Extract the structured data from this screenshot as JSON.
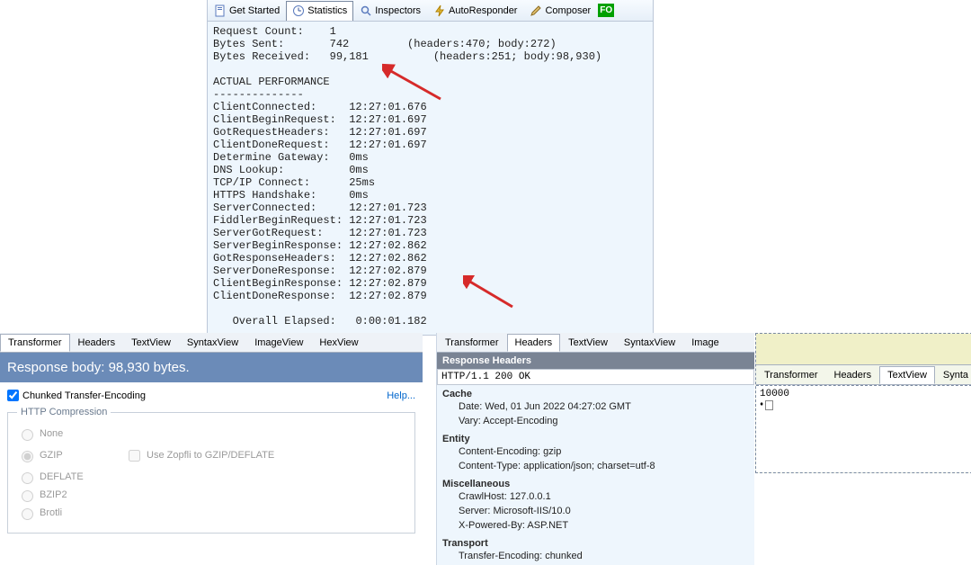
{
  "top": {
    "tabs": {
      "get_started": "Get Started",
      "statistics": "Statistics",
      "inspectors": "Inspectors",
      "autoresponder": "AutoResponder",
      "composer": "Composer",
      "fo": "FO"
    },
    "stats": {
      "request_count_label": "Request Count:    ",
      "request_count_value": "1",
      "bytes_sent_label": "Bytes Sent:       ",
      "bytes_sent_value": "742",
      "bytes_sent_detail": "(headers:470; body:272)",
      "bytes_received_label": "Bytes Received:   ",
      "bytes_received_value": "99,181",
      "bytes_received_detail": "(headers:251; body:98,930)",
      "actual_perf": "ACTUAL PERFORMANCE",
      "rule": "--------------",
      "rows": [
        [
          "ClientConnected:     ",
          "12:27:01.676"
        ],
        [
          "ClientBeginRequest:  ",
          "12:27:01.697"
        ],
        [
          "GotRequestHeaders:   ",
          "12:27:01.697"
        ],
        [
          "ClientDoneRequest:   ",
          "12:27:01.697"
        ],
        [
          "Determine Gateway:   ",
          "0ms"
        ],
        [
          "DNS Lookup:          ",
          "0ms"
        ],
        [
          "TCP/IP Connect:      ",
          "25ms"
        ],
        [
          "HTTPS Handshake:     ",
          "0ms"
        ],
        [
          "ServerConnected:     ",
          "12:27:01.723"
        ],
        [
          "FiddlerBeginRequest: ",
          "12:27:01.723"
        ],
        [
          "ServerGotRequest:    ",
          "12:27:01.723"
        ],
        [
          "ServerBeginResponse: ",
          "12:27:02.862"
        ],
        [
          "GotResponseHeaders:  ",
          "12:27:02.862"
        ],
        [
          "ServerDoneResponse:  ",
          "12:27:02.879"
        ],
        [
          "ClientBeginResponse: ",
          "12:27:02.879"
        ],
        [
          "ClientDoneResponse:  ",
          "12:27:02.879"
        ]
      ],
      "overall_label": "   Overall Elapsed:   ",
      "overall_value": "0:00:01.182"
    }
  },
  "bl": {
    "tabs": [
      "Transformer",
      "Headers",
      "TextView",
      "SyntaxView",
      "ImageView",
      "HexView"
    ],
    "response_body": "Response body: 98,930 bytes.",
    "chunked": "Chunked Transfer-Encoding",
    "help": "Help...",
    "compress_legend": "HTTP Compression",
    "radios": [
      "None",
      "GZIP",
      "DEFLATE",
      "BZIP2",
      "Brotli"
    ],
    "zopfli": "Use Zopfli to GZIP/DEFLATE"
  },
  "bm": {
    "tabs": [
      "Transformer",
      "Headers",
      "TextView",
      "SyntaxView",
      "Image"
    ],
    "bar": "Response Headers",
    "status": "HTTP/1.1 200 OK",
    "groups": [
      {
        "title": "Cache",
        "items": [
          "Date: Wed, 01 Jun 2022 04:27:02 GMT",
          "Vary: Accept-Encoding"
        ]
      },
      {
        "title": "Entity",
        "items": [
          "Content-Encoding: gzip",
          "Content-Type: application/json; charset=utf-8"
        ]
      },
      {
        "title": "Miscellaneous",
        "items": [
          "CrawlHost: 127.0.0.1",
          "Server: Microsoft-IIS/10.0",
          "X-Powered-By: ASP.NET"
        ]
      },
      {
        "title": "Transport",
        "items": [
          "Transfer-Encoding: chunked"
        ]
      }
    ]
  },
  "br": {
    "tabs": [
      "Transformer",
      "Headers",
      "TextView",
      "Synta"
    ],
    "lines": [
      "10000",
      "◇"
    ]
  }
}
